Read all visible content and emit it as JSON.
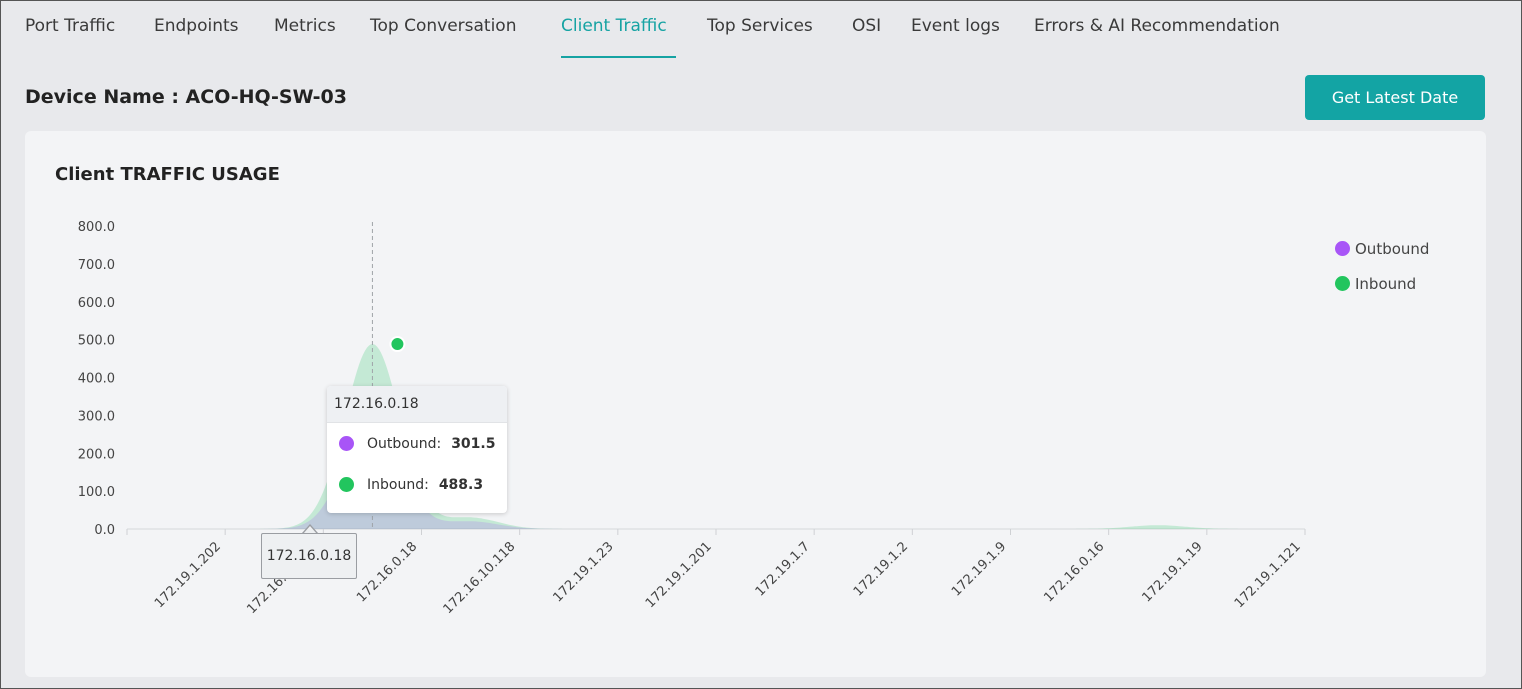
{
  "tabs": [
    {
      "label": "Port Traffic",
      "active": false
    },
    {
      "label": "Endpoints",
      "active": false
    },
    {
      "label": "Metrics",
      "active": false
    },
    {
      "label": "Top Conversation",
      "active": false
    },
    {
      "label": "Client Traffic",
      "active": true
    },
    {
      "label": "Top Services",
      "active": false
    },
    {
      "label": "OSI",
      "active": false
    },
    {
      "label": "Event logs",
      "active": false
    },
    {
      "label": "Errors & AI Recommendation",
      "active": false
    }
  ],
  "device": {
    "title": "Device Name : ACO-HQ-SW-03"
  },
  "actions": {
    "get_latest_label": "Get Latest Date"
  },
  "colors": {
    "accent": "#13a4a4",
    "outbound": "#a855f7",
    "inbound": "#22c55e"
  },
  "tooltip": {
    "header": "172.16.0.18",
    "rows": [
      {
        "label": "Outbound:",
        "value": "301.5"
      },
      {
        "label": "Inbound:",
        "value": "488.3"
      }
    ]
  },
  "x_flag": "172.16.0.18",
  "chart_data": {
    "type": "area",
    "title": "Client TRAFFIC USAGE",
    "xlabel": "",
    "ylabel": "",
    "ylim": [
      0,
      800
    ],
    "y_ticks": [
      "800.0",
      "700.0",
      "600.0",
      "500.0",
      "400.0",
      "300.0",
      "200.0",
      "100.0",
      "0.0"
    ],
    "categories": [
      "172.19.1.202",
      "172.16.250.38",
      "172.16.0.18",
      "172.16.10.118",
      "172.19.1.23",
      "172.19.1.201",
      "172.19.1.7",
      "172.19.1.2",
      "172.19.1.9",
      "172.16.0.16",
      "172.19.1.19",
      "172.19.1.121"
    ],
    "series": [
      {
        "name": "Outbound",
        "color": "#a855f7",
        "values": [
          0,
          0,
          301.5,
          20,
          0,
          0,
          0,
          0,
          0,
          0,
          0,
          0
        ]
      },
      {
        "name": "Inbound",
        "color": "#22c55e",
        "values": [
          0,
          0,
          488.3,
          30,
          0,
          0,
          0,
          0,
          0,
          0,
          10,
          0
        ]
      }
    ],
    "legend_position": "right",
    "grid": false
  }
}
